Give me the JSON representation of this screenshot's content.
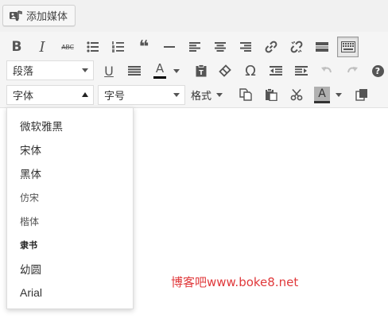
{
  "media": {
    "add_media_label": "添加媒体"
  },
  "toolbar": {
    "row1": [
      "bold",
      "italic",
      "strikethrough",
      "bullet-list",
      "numbered-list",
      "blockquote",
      "horizontal-rule",
      "align-left",
      "align-center",
      "align-right",
      "insert-link",
      "remove-link",
      "read-more",
      "toolbar-toggle"
    ],
    "bold_glyph": "B",
    "italic_glyph": "I",
    "strike_glyph": "ABC",
    "quote_glyph": "❝",
    "omega_glyph": "Ω",
    "help_glyph": "?",
    "paragraph_select": "段落",
    "font_family_select": "字体",
    "font_size_select": "字号",
    "formats_label": "格式",
    "text_color_letter": "A",
    "bg_color_letter": "A",
    "underline_glyph": "U"
  },
  "font_menu": {
    "items": [
      "微软雅黑",
      "宋体",
      "黑体",
      "仿宋",
      "楷体",
      "隶书",
      "幼圆",
      "Arial"
    ]
  },
  "watermark": {
    "text": "博客吧www.boke8.net"
  },
  "colors": {
    "text_color_bar": "#000000",
    "bg_color_fill": "#b0b0b0",
    "watermark": "#e0393b"
  }
}
